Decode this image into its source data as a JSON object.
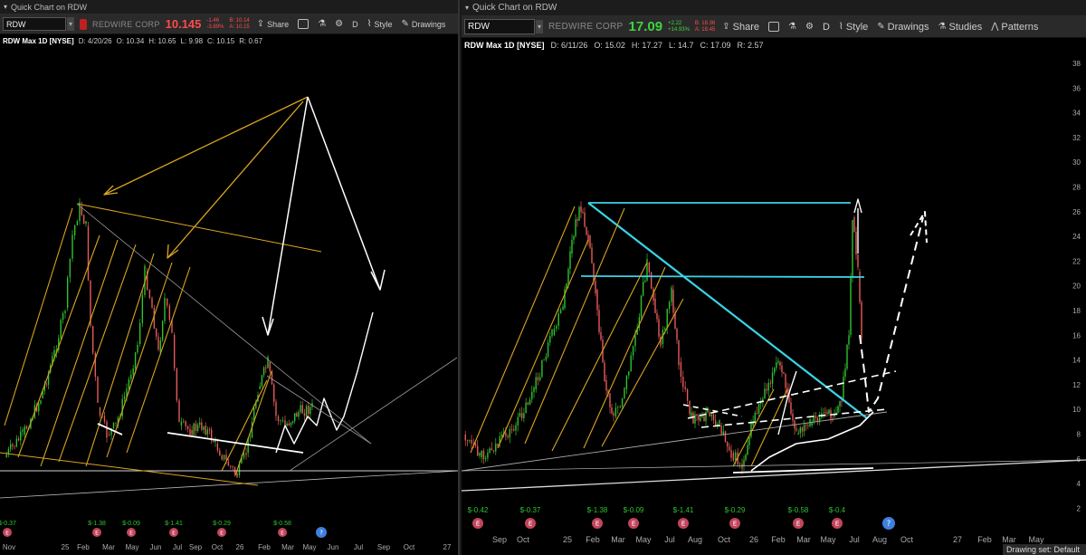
{
  "left": {
    "window_title": "Quick Chart on RDW",
    "symbol": "RDW",
    "company": "REDWIRE CORP",
    "price": "10.145",
    "change": [
      "-1.46",
      "-3.89%"
    ],
    "bid_ask": [
      "B: 10.14",
      "A: 10.15"
    ],
    "share_label": "Share",
    "period": "D",
    "style_label": "Style",
    "drawings_label": "Drawings",
    "chart_title": "RDW Max 1D [NYSE]",
    "ohlc": {
      "d": "D: 4/20/26",
      "o": "O: 10.34",
      "h": "H: 10.65",
      "l": "L: 9.98",
      "c": "C: 10.15",
      "r": "R: 0.67"
    },
    "x_labels": [
      "Nov",
      "25",
      "Feb",
      "Mar",
      "May",
      "Jun",
      "Jul",
      "Sep",
      "Oct",
      "26",
      "Feb",
      "Mar",
      "May",
      "Jun",
      "Jul",
      "Sep",
      "Oct",
      "27"
    ],
    "events": [
      {
        "label": "$-0.37",
        "sym": "E"
      },
      {
        "label": "$-1.38",
        "sym": "E"
      },
      {
        "label": "$-0.09",
        "sym": "E"
      },
      {
        "label": "$-1.41",
        "sym": "E"
      },
      {
        "label": "$-0.29",
        "sym": "E"
      },
      {
        "label": "$-0.58",
        "sym": "E"
      },
      {
        "label": "",
        "sym": "?"
      }
    ]
  },
  "right": {
    "window_title": "Quick Chart on RDW",
    "symbol": "RDW",
    "company": "REDWIRE CORP",
    "price": "17.09",
    "change": [
      "+2.22",
      "+14.93%"
    ],
    "bid_ask": [
      "B: 18.36",
      "A: 18.45"
    ],
    "share_label": "Share",
    "period": "D",
    "style_label": "Style",
    "drawings_label": "Drawings",
    "studies_label": "Studies",
    "patterns_label": "Patterns",
    "chart_title": "RDW Max 1D [NYSE]",
    "ohlc": {
      "d": "D: 6/11/26",
      "o": "O: 15.02",
      "h": "H: 17.27",
      "l": "L: 14.7",
      "c": "C: 17.09",
      "r": "R: 2.57"
    },
    "y_labels": [
      "38",
      "36",
      "34",
      "32",
      "30",
      "28",
      "26",
      "24",
      "22",
      "20",
      "18",
      "16",
      "14",
      "12",
      "10",
      "8",
      "6",
      "4",
      "2"
    ],
    "x_labels": [
      "Sep",
      "Oct",
      "25",
      "Feb",
      "Mar",
      "May",
      "Jul",
      "Aug",
      "Oct",
      "26",
      "Feb",
      "Mar",
      "May",
      "Jul",
      "Aug",
      "Oct",
      "27",
      "Feb",
      "Mar",
      "May"
    ],
    "events": [
      {
        "label": "$-0.42",
        "sym": "E"
      },
      {
        "label": "$-0.37",
        "sym": "E"
      },
      {
        "label": "$-1.38",
        "sym": "E"
      },
      {
        "label": "$-0.09",
        "sym": "E"
      },
      {
        "label": "$-1.41",
        "sym": "E"
      },
      {
        "label": "$-0.29",
        "sym": "E"
      },
      {
        "label": "$-0.58",
        "sym": "E"
      },
      {
        "label": "$-0.4",
        "sym": "E"
      },
      {
        "label": "",
        "sym": "?"
      }
    ],
    "status_text": "Drawing set: Default"
  },
  "colors": {
    "up": "#2ec42e",
    "down": "#e85a5a",
    "trend_gold": "#d9a520",
    "trend_white": "#ffffff",
    "trend_cyan": "#3ad4e6",
    "earnings_badge": "#c2455c",
    "question_badge": "#3f7fe0"
  }
}
